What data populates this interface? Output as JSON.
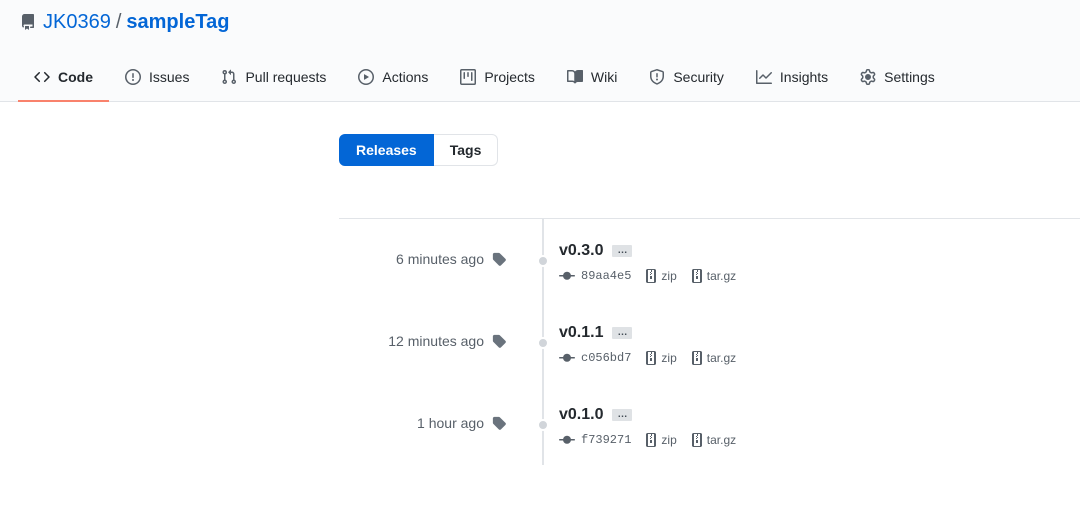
{
  "repo": {
    "owner": "JK0369",
    "separator": "/",
    "name": "sampleTag"
  },
  "tabs": [
    {
      "label": "Code",
      "icon": "code-icon"
    },
    {
      "label": "Issues",
      "icon": "issue-icon"
    },
    {
      "label": "Pull requests",
      "icon": "pull-request-icon"
    },
    {
      "label": "Actions",
      "icon": "play-icon"
    },
    {
      "label": "Projects",
      "icon": "project-icon"
    },
    {
      "label": "Wiki",
      "icon": "book-icon"
    },
    {
      "label": "Security",
      "icon": "shield-icon"
    },
    {
      "label": "Insights",
      "icon": "graph-icon"
    },
    {
      "label": "Settings",
      "icon": "gear-icon"
    }
  ],
  "subnav": {
    "releases": "Releases",
    "tags": "Tags"
  },
  "releases": [
    {
      "time": "6 minutes ago",
      "tag": "v0.3.0",
      "ellipsis": "…",
      "sha": "89aa4e5",
      "zip": "zip",
      "targz": "tar.gz"
    },
    {
      "time": "12 minutes ago",
      "tag": "v0.1.1",
      "ellipsis": "…",
      "sha": "c056bd7",
      "zip": "zip",
      "targz": "tar.gz"
    },
    {
      "time": "1 hour ago",
      "tag": "v0.1.0",
      "ellipsis": "…",
      "sha": "f739271",
      "zip": "zip",
      "targz": "tar.gz"
    }
  ],
  "colors": {
    "link": "#0366d6",
    "selected_tab_border": "#f9826c",
    "muted": "#586069"
  }
}
